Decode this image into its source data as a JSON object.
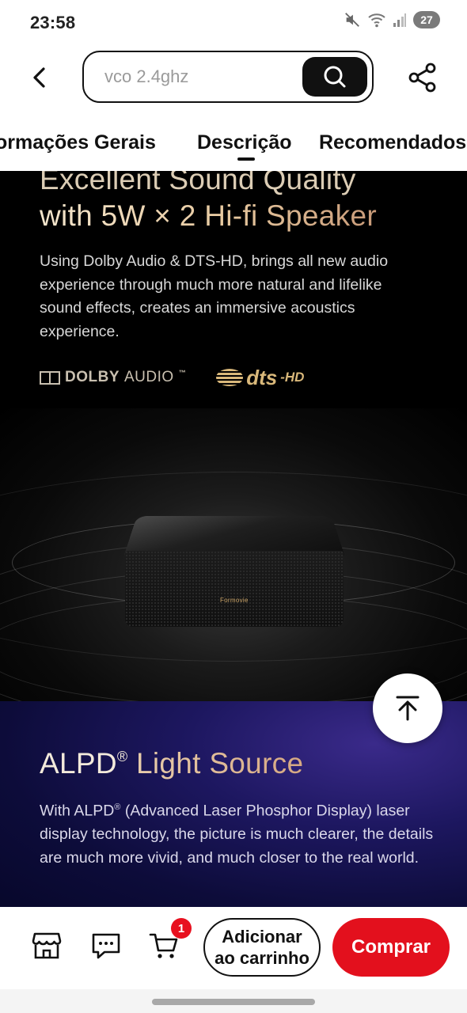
{
  "status_bar": {
    "time": "23:58",
    "battery": "27",
    "icons": [
      "mute-icon",
      "wifi-icon",
      "signal-icon",
      "battery-icon"
    ]
  },
  "header": {
    "search_value": "vco 2.4ghz",
    "icons": [
      "back-arrow-icon",
      "search-icon",
      "share-icon"
    ]
  },
  "tabs": [
    {
      "label": "ormações Gerais"
    },
    {
      "label": "Descrição",
      "active": true
    },
    {
      "label": "Recomendados"
    }
  ],
  "description": {
    "section1": {
      "title_line1": "Excellent Sound Quality",
      "title_line2": "with 5W × 2 Hi-fi Speaker",
      "paragraph": "Using Dolby Audio & DTS-HD, brings all new audio experience through much more natural and lifelike sound effects, creates an immersive acoustics experience.",
      "logo_dolby_name": "DOLBY",
      "logo_dolby_sub": "AUDIO",
      "logo_dolby_tm": "™",
      "logo_dts": "dts",
      "logo_dts_sub": "-HD",
      "product_brand": "Formovie"
    },
    "section2": {
      "title_a": "ALPD",
      "title_reg": "®",
      "title_b": " Light Source",
      "paragraph_start": "With ALPD",
      "paragraph_reg": "®",
      "paragraph_rest": " (Advanced Laser Phosphor Display) laser display technology, the picture is much clearer, the details are much more vivid, and much closer to the real world."
    }
  },
  "scroll_top": {
    "icon": "arrow-up-to-top-icon"
  },
  "bottom_bar": {
    "cart_count": "1",
    "add_to_cart_line1": "Adicionar",
    "add_to_cart_line2": "ao carrinho",
    "buy_label": "Comprar",
    "icons": [
      "store-icon",
      "chat-icon",
      "cart-icon"
    ]
  },
  "colors": {
    "accent_red": "#e3101d",
    "badge_red": "#e8101f",
    "gold_text": "#e8d9bf",
    "section2_bg": "#1d1760"
  }
}
